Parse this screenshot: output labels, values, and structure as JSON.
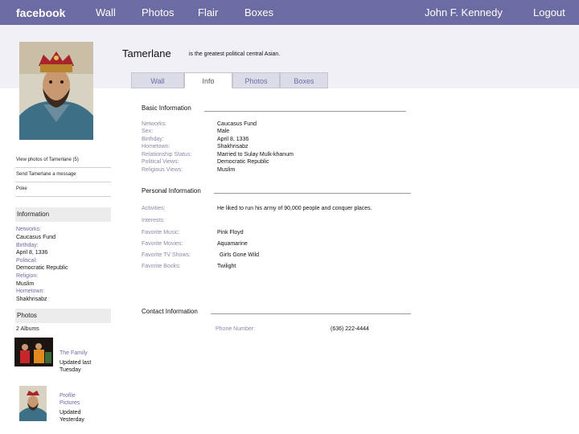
{
  "nav": {
    "logo": "facebook",
    "links": [
      "Wall",
      "Photos",
      "Flair",
      "Boxes"
    ],
    "user": "John F. Kennedy",
    "logout": "Logout"
  },
  "profile": {
    "name": "Tamerlane",
    "status": "is the greatest political central Asian."
  },
  "tabs": [
    "Wall",
    "Info",
    "Photos",
    "Boxes"
  ],
  "active_tab": "Info",
  "sidebar": {
    "view_photos": "View photos of Tamerlane (5)",
    "send_message": "Send Tamerlane a message",
    "poke": "Poke",
    "information_header": "Information",
    "info": [
      {
        "label": "Networks:",
        "value": "Caucasus Fund"
      },
      {
        "label": "Birthday:",
        "value": "April 8, 1336"
      },
      {
        "label": "Political:",
        "value": "Democratic Republic"
      },
      {
        "label": "Religion:",
        "value": "Muslim"
      },
      {
        "label": "Hometown:",
        "value": "Shakhrisabz"
      }
    ],
    "photos_header": "Photos",
    "albums_count": "2 Albums",
    "albums": [
      {
        "title": "The Family",
        "updated_label": "Updated last",
        "updated_value": "Tuesday"
      },
      {
        "title": "Profile",
        "title2": "Pictures",
        "updated_label": "Updated",
        "updated_value": "Yesterday"
      }
    ]
  },
  "basic_info": {
    "title": "Basic Information",
    "rows": [
      {
        "label": "Networks:",
        "value": "Caucasus Fund"
      },
      {
        "label": "Sex:",
        "value": "Male"
      },
      {
        "label": "Birthday:",
        "value": "April 8, 1336"
      },
      {
        "label": "Hometown:",
        "value": "Shakhrisabz"
      },
      {
        "label": "Relationship Status:",
        "value": "Married to Sulay Mulk-khanum"
      },
      {
        "label": "Political Views:",
        "value": "Democratic Republic"
      },
      {
        "label": "Religious Views:",
        "value": "Muslim"
      }
    ]
  },
  "personal_info": {
    "title": "Personal Information",
    "activities_label": "Activities:",
    "activities_value": "He liked to run his army of 90,000 people and conquer places.",
    "interests_label": "Interests:",
    "music_label": "Favorite Music:",
    "music_value": "Pink Floyd",
    "movies_label": "Favorite Movies:",
    "movies_value": "Aquamarine",
    "tv_label": "Favorite TV Shows:",
    "tv_value": "Girls Gone Wild",
    "books_label": "Favorite Books:",
    "books_value": "Twilight"
  },
  "contact_info": {
    "title": "Contact Information",
    "phone_label": "Phone Number:",
    "phone_value": "(636) 222-4444"
  },
  "colors": {
    "nav_bar": "#6d6ba3",
    "light_band": "#f0f0f6",
    "link": "#6d6ba3",
    "label": "#8a8aa6"
  }
}
